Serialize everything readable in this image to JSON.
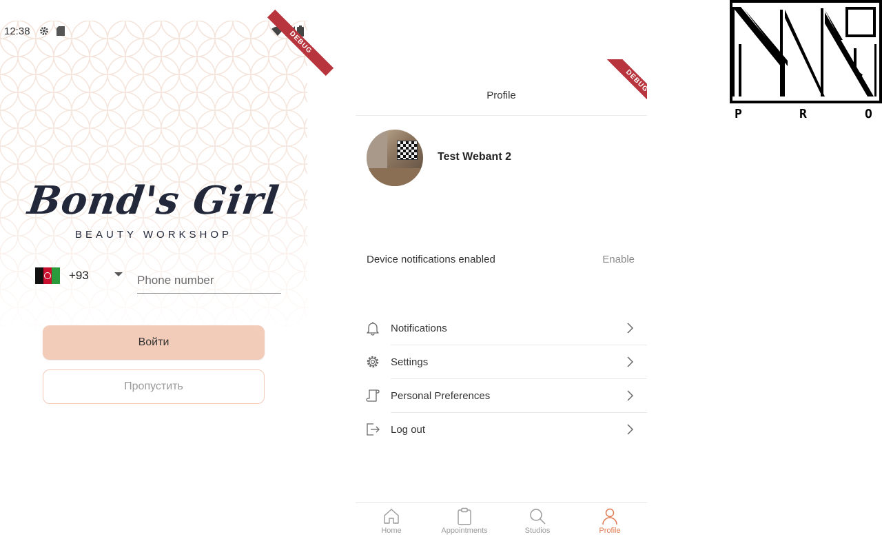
{
  "login": {
    "status": {
      "time": "12:38",
      "debug": "DEBUG"
    },
    "brand": {
      "name": "Bond's Girl",
      "subtitle": "BEAUTY WORKSHOP"
    },
    "phone": {
      "dial_code": "+93",
      "placeholder": "Phone number",
      "flag": "afghanistan-flag"
    },
    "login_button": "Войти",
    "skip_button": "Пропустить",
    "colors": {
      "accent": "#f2cbb9",
      "brand_text": "#22283a",
      "pattern": "#f4e3da"
    }
  },
  "profile": {
    "debug": "DEBUG",
    "title": "Profile",
    "user_name": "Test Webant 2",
    "device_notifications": {
      "label": "Device notifications enabled",
      "action": "Enable"
    },
    "menu": [
      {
        "label": "Notifications",
        "icon": "bell-icon"
      },
      {
        "label": "Settings",
        "icon": "gear-icon"
      },
      {
        "label": "Personal Preferences",
        "icon": "scroll-icon"
      },
      {
        "label": "Log out",
        "icon": "logout-icon"
      }
    ],
    "tabs": [
      {
        "label": "Home",
        "icon": "home-icon",
        "active": false
      },
      {
        "label": "Appointments",
        "icon": "clipboard-icon",
        "active": false
      },
      {
        "label": "Studios",
        "icon": "search-icon",
        "active": false
      },
      {
        "label": "Profile",
        "icon": "user-icon",
        "active": true
      }
    ],
    "colors": {
      "active_tab": "#e07a50",
      "inactive_tab": "#9a9a9a"
    }
  },
  "logo": {
    "letters": [
      "P",
      "R",
      "O"
    ]
  }
}
